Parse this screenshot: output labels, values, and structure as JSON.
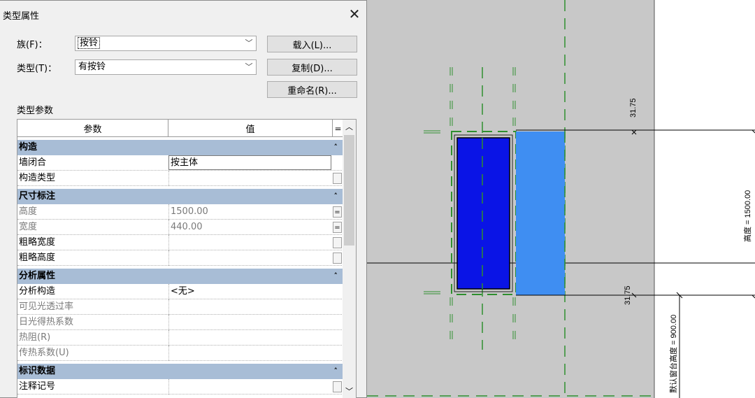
{
  "dialog": {
    "title": "类型属性",
    "close_glyph": "✕",
    "family_label": "族(F)：",
    "family_value": "按铃",
    "type_label": "类型(T)：",
    "type_value": "有按铃",
    "load_button": "载入(L)...",
    "duplicate_button": "复制(D)...",
    "rename_button": "重命名(R)...",
    "section_label": "类型参数",
    "combo_arrow": "﹀"
  },
  "table": {
    "col_param": "参数",
    "col_value": "值",
    "col_eq": "=",
    "groups": [
      {
        "name": "构造",
        "rows": [
          {
            "name": "墙闭合",
            "value": "按主体"
          },
          {
            "name": "构造类型",
            "value": ""
          }
        ]
      },
      {
        "name": "尺寸标注",
        "rows": [
          {
            "name": "高度",
            "value": "1500.00"
          },
          {
            "name": "宽度",
            "value": "440.00"
          },
          {
            "name": "粗略宽度",
            "value": ""
          },
          {
            "name": "粗略高度",
            "value": ""
          }
        ]
      },
      {
        "name": "分析属性",
        "rows": [
          {
            "name": "分析构造",
            "value": "<无>"
          },
          {
            "name": "可见光透过率",
            "value": ""
          },
          {
            "name": "日光得热系数",
            "value": ""
          },
          {
            "name": "热阻(R)",
            "value": ""
          },
          {
            "name": "传热系数(U)",
            "value": ""
          }
        ]
      },
      {
        "name": "标识数据",
        "rows": [
          {
            "name": "注释记号",
            "value": ""
          }
        ]
      }
    ],
    "collapse_glyph": "˄",
    "eq_glyph": "="
  },
  "scrollbar": {
    "up": "︿",
    "down": "﹀"
  },
  "drawing": {
    "dim_top": "31.75",
    "dim_bottom": "31.75",
    "dim_height": "高度 = 1500.00",
    "dim_sill": "默认窗台高度 = 900.00",
    "colors": {
      "dark_blue": "#0a14e6",
      "light_blue": "#3f8ef2",
      "green": "#3c9a3c",
      "background": "#c8c8c8"
    }
  }
}
